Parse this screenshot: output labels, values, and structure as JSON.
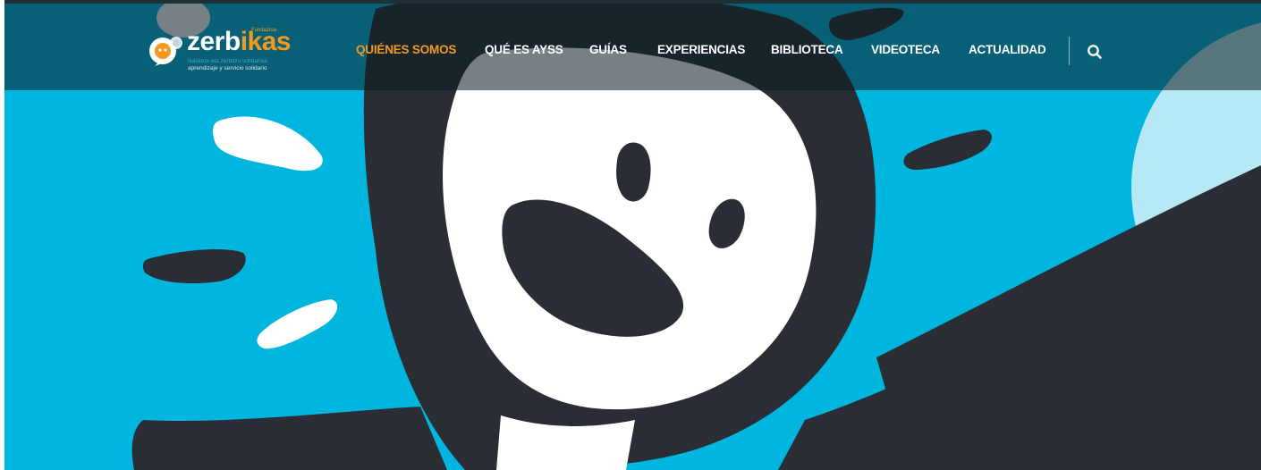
{
  "brand": {
    "prefix": "zerb",
    "accent": "ikas",
    "foundation": "Fundazioa",
    "tagline_1": "ikasketa eta zerbitzu solidarioa",
    "tagline_2": "aprendizaje y servicio solidario",
    "accent_color": "#f29a1f",
    "icon": "speech-bubbles-logo-icon"
  },
  "nav": {
    "items": [
      {
        "label": "QUIÉNES SOMOS",
        "active": true
      },
      {
        "label": "QUÉ ES AYSS",
        "active": false
      },
      {
        "label": "GUÍAS",
        "active": false
      },
      {
        "label": "EXPERIENCIAS",
        "active": false
      },
      {
        "label": "BIBLIOTECA",
        "active": false
      },
      {
        "label": "VIDEOTECA",
        "active": false
      },
      {
        "label": "ACTUALIDAD",
        "active": false
      }
    ],
    "search_icon": "search-icon"
  },
  "hero": {
    "background_color": "#00b6df",
    "figure_color": "#2a2d33",
    "illustration": "smiling-figure-illustration"
  }
}
